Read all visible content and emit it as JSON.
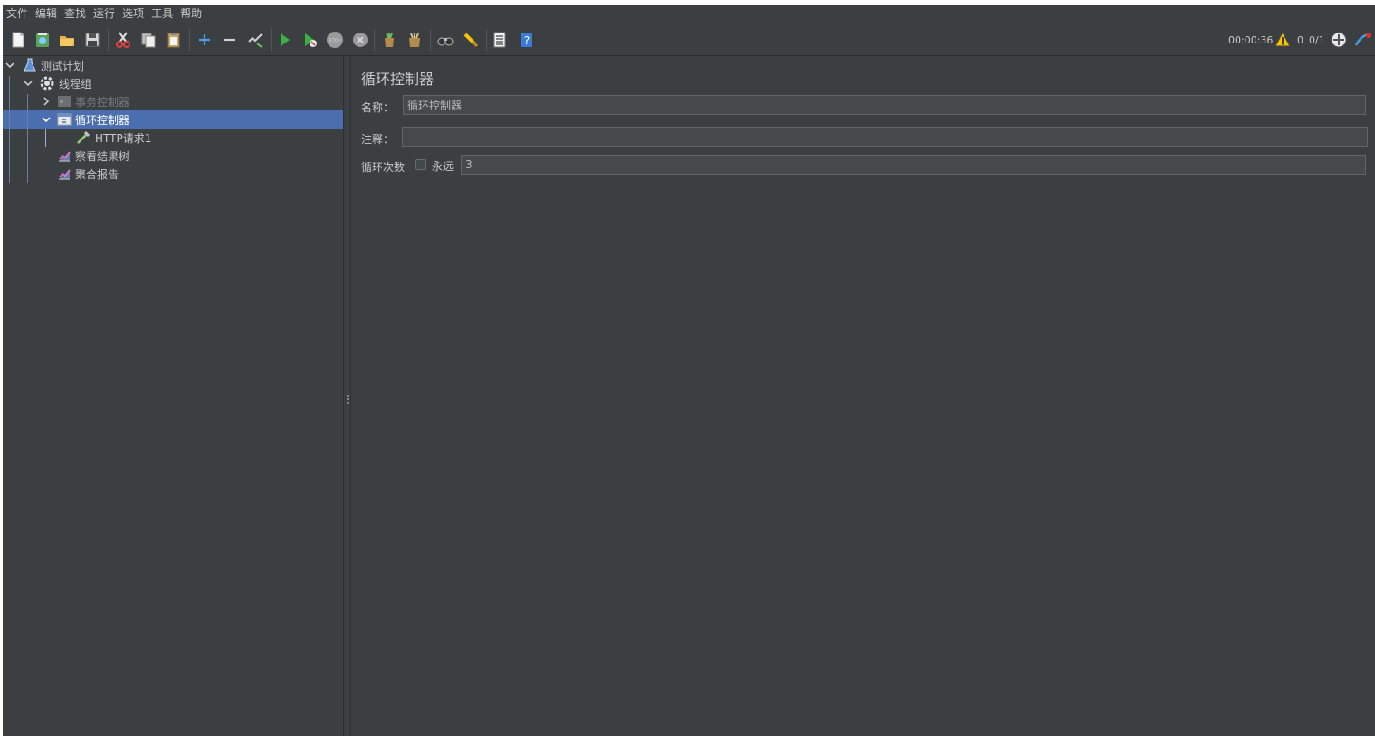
{
  "menu": [
    "文件",
    "编辑",
    "查找",
    "运行",
    "选项",
    "工具",
    "帮助"
  ],
  "status": {
    "elapsed": "00:00:36",
    "warnings": "0",
    "threads": "0/1"
  },
  "tree": [
    {
      "label": "测试计划",
      "icon": "flask-icon",
      "expanded": true
    },
    {
      "label": "线程组",
      "icon": "gear-icon",
      "expanded": true
    },
    {
      "label": "事务控制器",
      "icon": "transaction-controller-icon",
      "disabled": true
    },
    {
      "label": "循环控制器",
      "icon": "loop-controller-icon",
      "expanded": true,
      "selected": true
    },
    {
      "label": "HTTP请求1",
      "icon": "pipette-icon"
    },
    {
      "label": "察看结果树",
      "icon": "chart-icon"
    },
    {
      "label": "聚合报告",
      "icon": "chart-icon"
    }
  ],
  "panel": {
    "title": "循环控制器",
    "name_label": "名称：",
    "name_value": "循环控制器",
    "comment_label": "注释：",
    "comment_value": "",
    "loop_label": "循环次数",
    "forever_label": "永远",
    "forever_checked": false,
    "loop_value": "3"
  },
  "colors": {
    "background": "#3c3f41",
    "selection": "#4b6eaf",
    "field": "#45494a"
  }
}
